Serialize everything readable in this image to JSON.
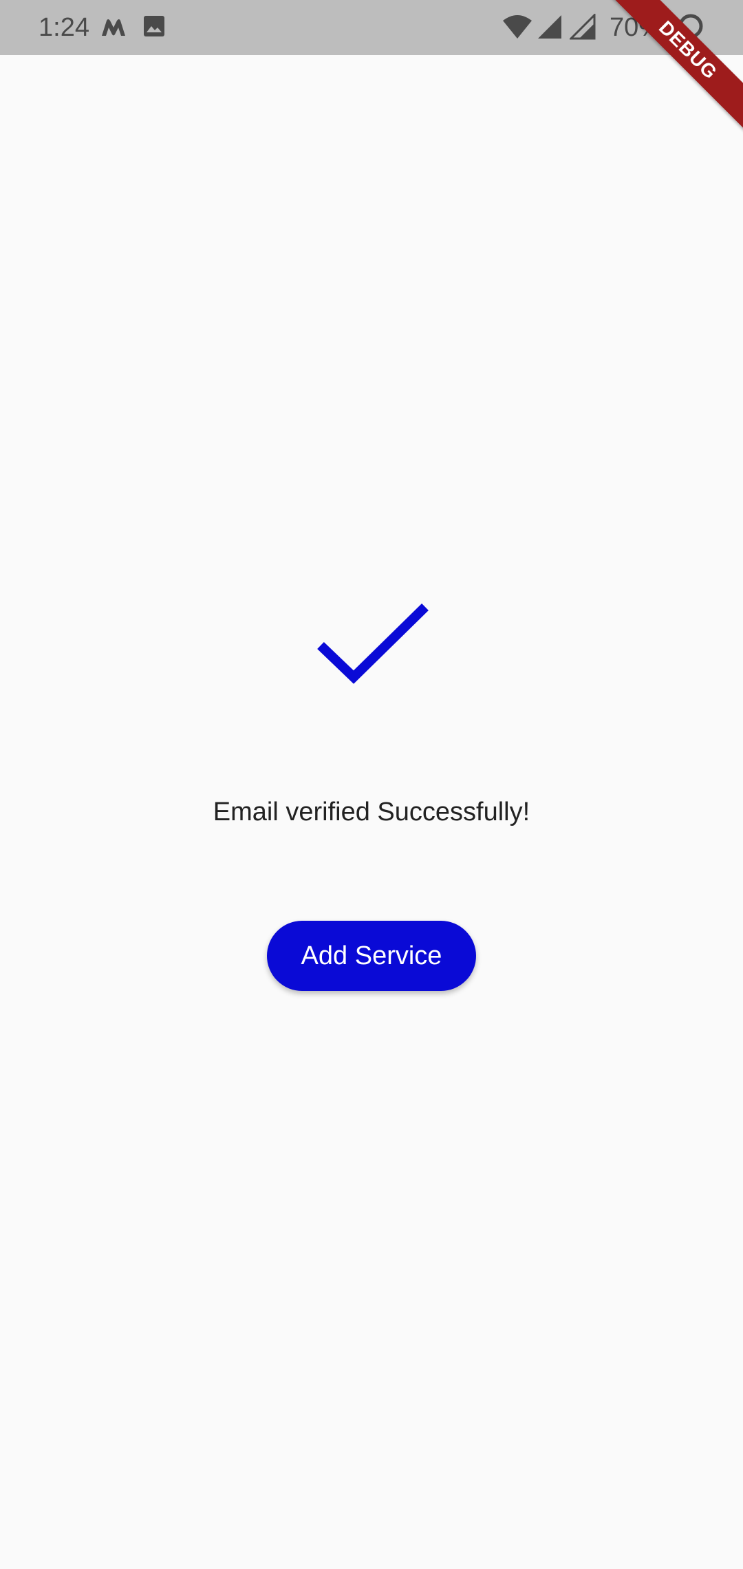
{
  "status_bar": {
    "time": "1:24",
    "battery": "70%",
    "icons": [
      "m-app-icon",
      "image-icon",
      "wifi-icon",
      "signal-icon",
      "signal-icon-2",
      "battery-icon"
    ]
  },
  "debug_banner": {
    "label": "DEBUG",
    "color": "#9e1c1c"
  },
  "main": {
    "icon": "check-icon",
    "message": "Email verified Successfully!",
    "button_label": "Add Service"
  },
  "colors": {
    "accent": "#0a0ad6",
    "background": "#fafafa",
    "status_bar": "#bdbdbd"
  }
}
